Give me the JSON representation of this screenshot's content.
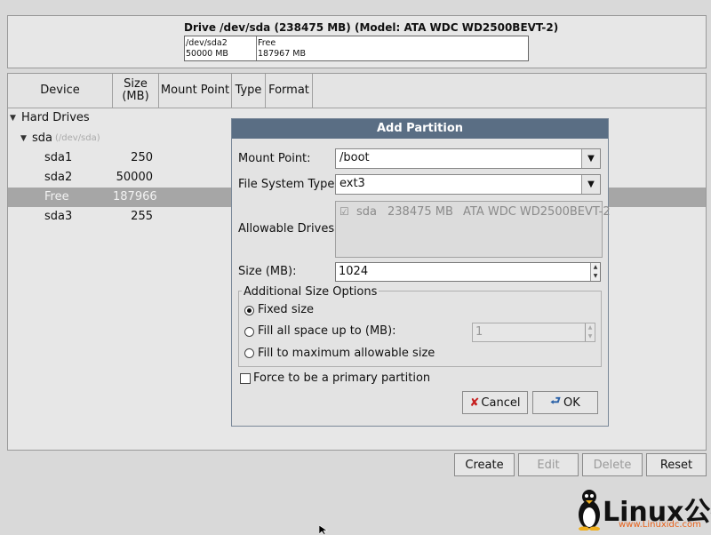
{
  "drive": {
    "title": "Drive /dev/sda (238475 MB) (Model: ATA WDC WD2500BEVT-2)",
    "segments": [
      {
        "name": "/dev/sda2",
        "size": "50000 MB"
      },
      {
        "name": "Free",
        "size": "187967 MB"
      }
    ]
  },
  "table": {
    "columns": [
      "Device",
      "Size\n(MB)",
      "Mount Point",
      "Type",
      "Format"
    ],
    "tree": {
      "group": "Hard Drives",
      "disk": "sda",
      "disk_path": "(/dev/sda)",
      "rows": [
        {
          "device": "sda1",
          "size": "250",
          "selected": false
        },
        {
          "device": "sda2",
          "size": "50000",
          "selected": false
        },
        {
          "device": "Free",
          "size": "187966",
          "selected": true
        },
        {
          "device": "sda3",
          "size": "255",
          "selected": false
        }
      ]
    }
  },
  "dialog": {
    "title": "Add Partition",
    "mount_point_label": "Mount Point:",
    "mount_point_value": "/boot",
    "fs_type_label": "File System Type:",
    "fs_type_value": "ext3",
    "allowable_drives_label": "Allowable Drives:",
    "drive_entry": {
      "name": "sda",
      "size": "238475 MB",
      "model": "ATA WDC WD2500BEVT-2"
    },
    "size_label": "Size (MB):",
    "size_value": "1024",
    "additional_label": "Additional Size Options",
    "options": [
      {
        "label": "Fixed size",
        "checked": true
      },
      {
        "label": "Fill all space up to (MB):",
        "checked": false
      },
      {
        "label": "Fill to maximum allowable size",
        "checked": false
      }
    ],
    "fill_value": "1",
    "primary_label": "Force to be a primary partition",
    "cancel_label": "Cancel",
    "ok_label": "OK"
  },
  "buttons": {
    "create": "Create",
    "edit": "Edit",
    "delete": "Delete",
    "reset": "Reset"
  },
  "watermark": {
    "text": "Linux公社",
    "url": "www.Linuxidc.com"
  }
}
